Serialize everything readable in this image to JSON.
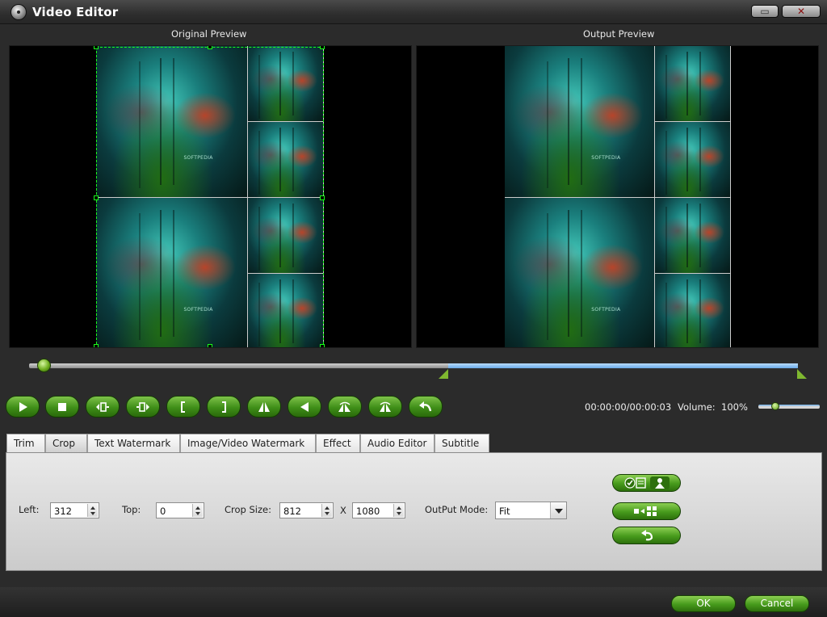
{
  "window": {
    "title": "Video Editor",
    "minimize_glyph": "▭",
    "close_glyph": "✕"
  },
  "preview": {
    "original_label": "Original Preview",
    "output_label": "Output Preview",
    "tile_caption": "SOFTPEDIA"
  },
  "playback": {
    "timecode": "00:00:00/00:00:03",
    "volume_label": "Volume:",
    "volume_value": "100%"
  },
  "tabs": [
    {
      "label": "Trim"
    },
    {
      "label": "Crop"
    },
    {
      "label": "Text Watermark"
    },
    {
      "label": "Image/Video Watermark"
    },
    {
      "label": "Effect"
    },
    {
      "label": "Audio Editor"
    },
    {
      "label": "Subtitle"
    }
  ],
  "active_tab": "Crop",
  "crop": {
    "left_label": "Left:",
    "left_value": "312",
    "top_label": "Top:",
    "top_value": "0",
    "size_label": "Crop Size:",
    "width_value": "812",
    "x_label": "X",
    "height_value": "1080",
    "mode_label": "OutPut Mode:",
    "mode_value": "Fit"
  },
  "footer": {
    "ok_label": "OK",
    "cancel_label": "Cancel"
  },
  "colors": {
    "accent_green": "#469a1c",
    "crop_guide": "#19ff19",
    "timeline_selection": "#6aa9e6"
  },
  "icons": [
    "play-icon",
    "stop-icon",
    "prev-frame-icon",
    "next-frame-icon",
    "mark-in-icon",
    "mark-out-icon",
    "flip-vertical-icon",
    "flip-horizontal-icon",
    "rotate-left-icon",
    "rotate-right-icon",
    "undo-icon",
    "keep-aspect-icon",
    "crop-mode-icon",
    "reset-icon"
  ]
}
